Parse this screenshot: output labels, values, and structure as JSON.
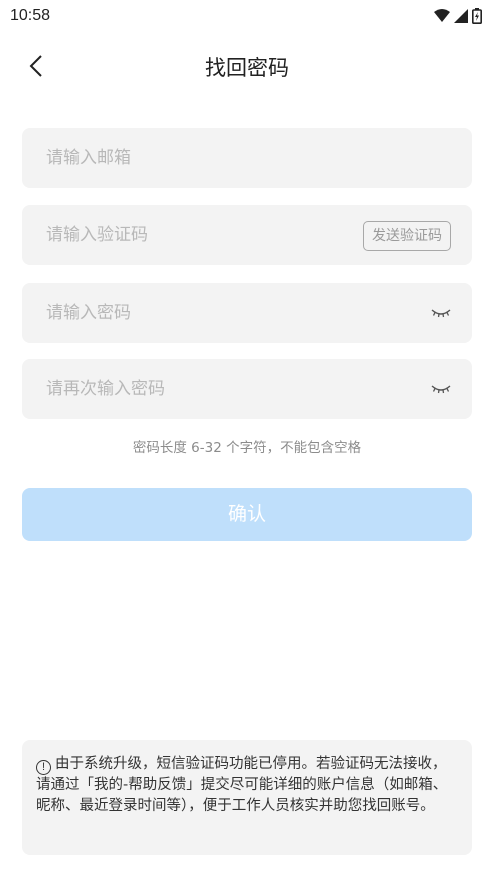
{
  "status_bar": {
    "time": "10:58",
    "icons": [
      "wifi-icon",
      "cellular-signal-icon",
      "battery-icon"
    ]
  },
  "header": {
    "back_icon": "chevron-left-icon",
    "title": "找回密码"
  },
  "form": {
    "email": {
      "placeholder": "请输入邮箱",
      "value": ""
    },
    "code": {
      "placeholder": "请输入验证码",
      "value": "",
      "send_button": "发送验证码"
    },
    "password": {
      "placeholder": "请输入密码",
      "value": "",
      "toggle_icon": "eye-closed-icon"
    },
    "password_confirm": {
      "placeholder": "请再次输入密码",
      "value": "",
      "toggle_icon": "eye-closed-icon"
    },
    "hint": "密码长度 6-32 个字符，不能包含空格",
    "confirm_label": "确认"
  },
  "notice": {
    "icon": "info-circle-icon",
    "icon_glyph": "!",
    "text": "由于系统升级，短信验证码功能已停用。若验证码无法接收，请通过「我的-帮助反馈」提交尽可能详细的账户信息（如邮箱、昵称、最近登录时间等），便于工作人员核实并助您找回账号。"
  },
  "colors": {
    "accent_disabled": "#bfdffb",
    "field_background": "#f3f3f3",
    "placeholder": "#b8b8b8"
  }
}
